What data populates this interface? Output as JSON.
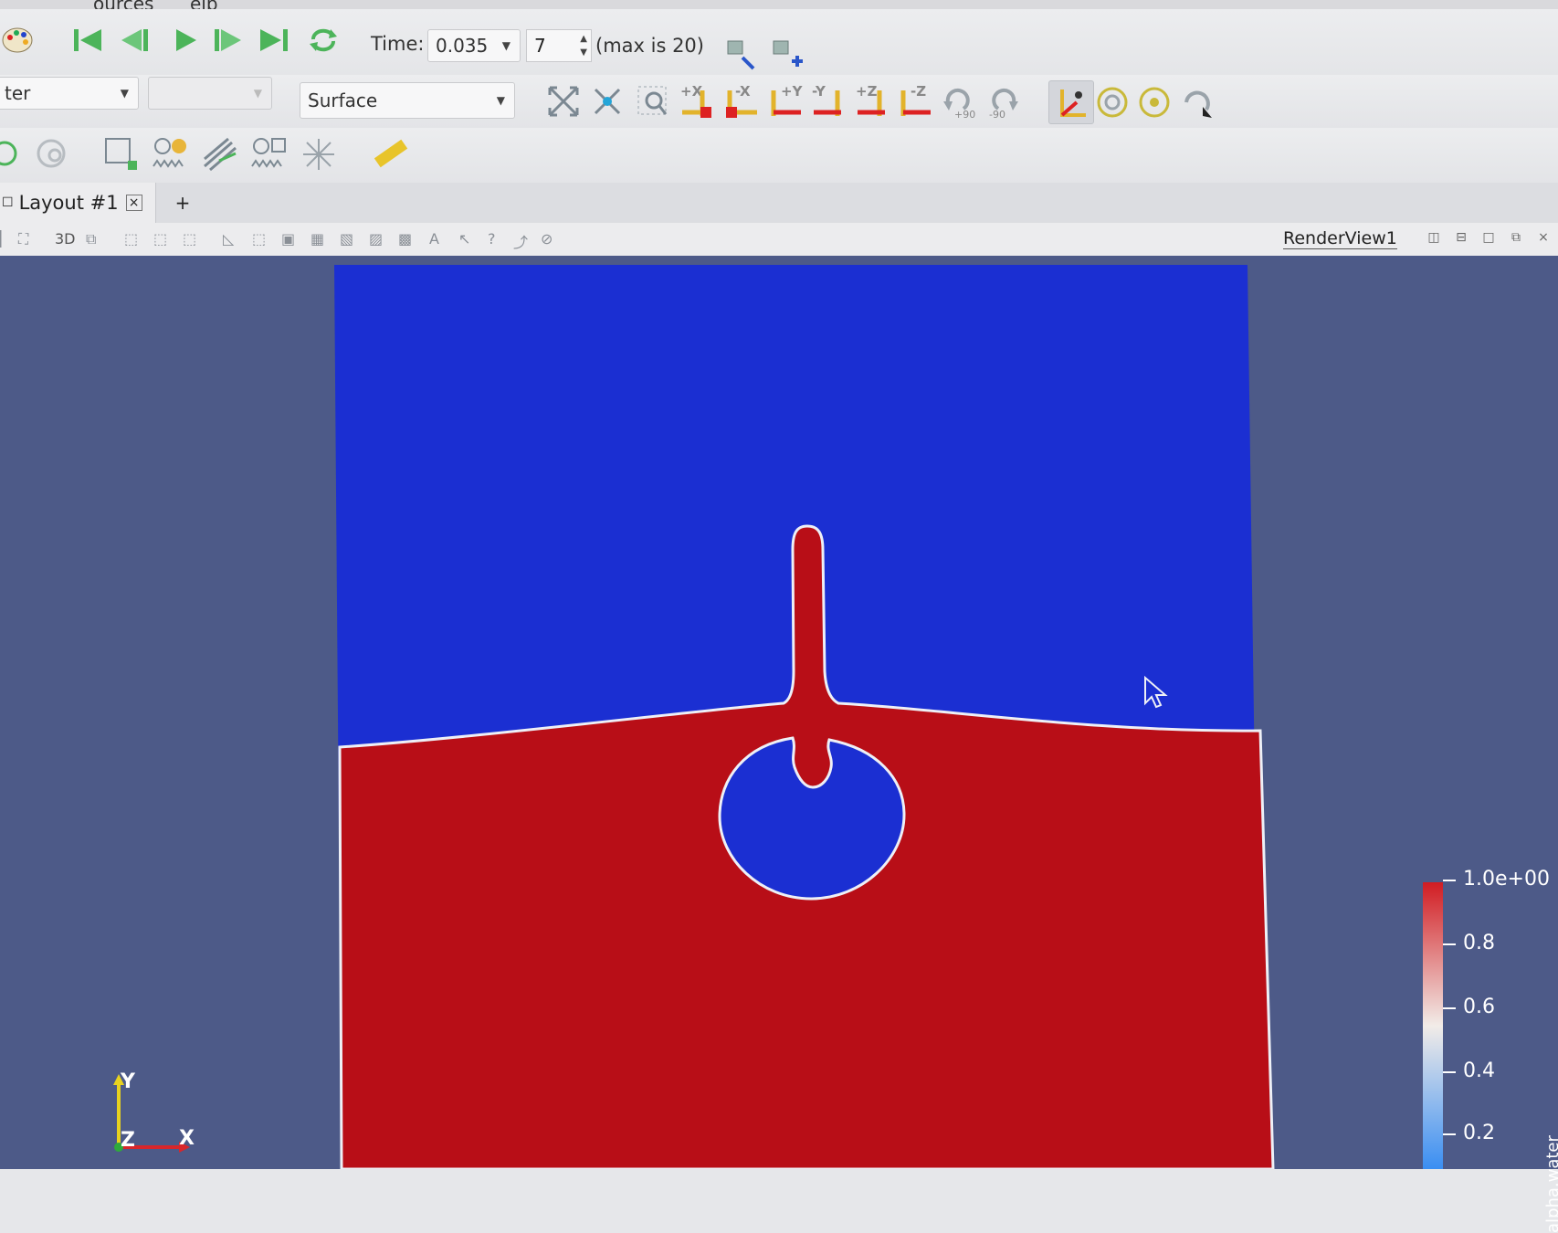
{
  "menu": {
    "fragment_1": "_ources",
    "fragment_2": "_elp"
  },
  "vcr": {
    "first_icon": "first-frame-icon",
    "prev_icon": "previous-frame-icon",
    "play_icon": "play-icon",
    "next_icon": "next-frame-icon",
    "last_icon": "last-frame-icon",
    "loop_icon": "loop-icon",
    "time_label": "Time:",
    "time_value": "0.035",
    "step_value": "7",
    "max_text": "(max is 20)"
  },
  "representation": {
    "filter_combo": "ter",
    "empty_combo": "",
    "representation_combo": "Surface"
  },
  "camera_buttons": {
    "plus_x": "+X",
    "minus_x": "-X",
    "plus_y": "+Y",
    "minus_y": "-Y",
    "plus_z": "+Z",
    "minus_z": "-Z",
    "rot_plus": "+90",
    "rot_minus": "-90"
  },
  "layout": {
    "tab_label": "Layout #1",
    "add_tab": "+"
  },
  "viewbar": {
    "mode_3d": "3D",
    "help": "?",
    "view_title": "RenderView1"
  },
  "scalar_bar": {
    "labels": [
      "1.0e+00",
      "0.8",
      "0.6",
      "0.4",
      "0.2"
    ],
    "title_partial": "alpha.water",
    "colors": {
      "high": "#d11c22",
      "mid": "#f2ece8",
      "low": "#3a8ef2"
    }
  },
  "orientation_axes": {
    "y": "Y",
    "z": "Z",
    "x": "X"
  },
  "colors": {
    "background": "#4d5a88",
    "air": "#1b2fd2",
    "water": "#b80e17",
    "interface": "#eef0f6"
  }
}
